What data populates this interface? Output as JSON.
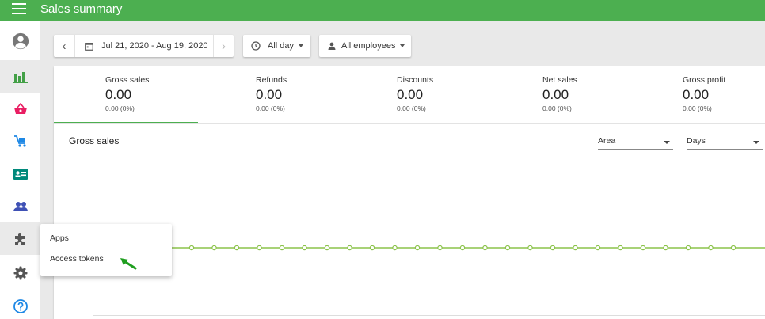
{
  "header": {
    "title": "Sales summary"
  },
  "sidebar": {
    "items": [
      {
        "name": "account",
        "icon": "account-circle-icon"
      },
      {
        "name": "reports",
        "icon": "bar-chart-icon"
      },
      {
        "name": "items",
        "icon": "basket-icon"
      },
      {
        "name": "inventory",
        "icon": "cart-icon"
      },
      {
        "name": "customers",
        "icon": "id-card-icon"
      },
      {
        "name": "employees",
        "icon": "people-icon"
      },
      {
        "name": "integrations",
        "icon": "puzzle-icon"
      },
      {
        "name": "settings",
        "icon": "gear-icon"
      },
      {
        "name": "help",
        "icon": "help-icon"
      }
    ]
  },
  "toolbar": {
    "prev_icon": "‹",
    "next_icon": "›",
    "date_range": "Jul 21, 2020 - Aug 19, 2020",
    "time_filter": "All day",
    "employee_filter": "All employees"
  },
  "summary": [
    {
      "label": "Gross sales",
      "value": "0.00",
      "change": "0.00 (0%)"
    },
    {
      "label": "Refunds",
      "value": "0.00",
      "change": "0.00 (0%)"
    },
    {
      "label": "Discounts",
      "value": "0.00",
      "change": "0.00 (0%)"
    },
    {
      "label": "Net sales",
      "value": "0.00",
      "change": "0.00 (0%)"
    },
    {
      "label": "Gross profit",
      "value": "0.00",
      "change": "0.00 (0%)"
    }
  ],
  "chart": {
    "title": "Gross sales",
    "type_select": "Area",
    "period_select": "Days"
  },
  "popup": {
    "items": [
      "Apps",
      "Access tokens"
    ]
  },
  "colors": {
    "brand": "#4caf50",
    "line": "#8bc34a"
  }
}
